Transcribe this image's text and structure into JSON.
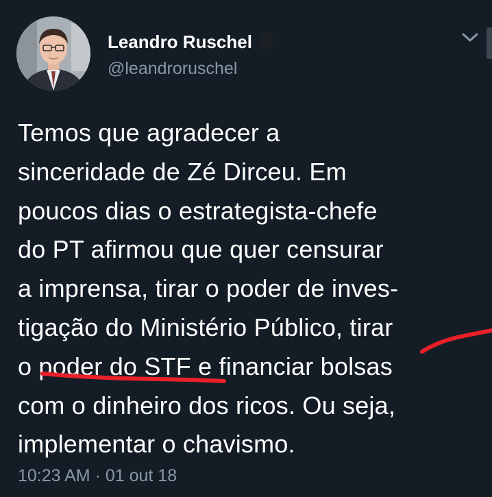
{
  "tweet": {
    "display_name": "Leandro Ruschel",
    "handle": "@leandroruschel",
    "speaker_icon": "speaking-head-icon",
    "menu_icon": "chevron-down-icon",
    "text": "Temos que agradecer a\nsinceridade de Zé Dirceu. Em\npoucos dias o estrategista-chefe\ndo PT afirmou que quer censurar\na imprensa, tirar o poder de inves-\ntigação do Ministério Público, tirar\no poder do STF e financiar bolsas\ncom o dinheiro dos ricos. Ou seja,\nimplementar o chavismo.",
    "timestamp": "10:23 AM · 01 out 18"
  },
  "colors": {
    "background": "#141d26",
    "text": "#ffffff",
    "secondary_text": "#8899a6",
    "annotation_red": "#e8202a"
  }
}
